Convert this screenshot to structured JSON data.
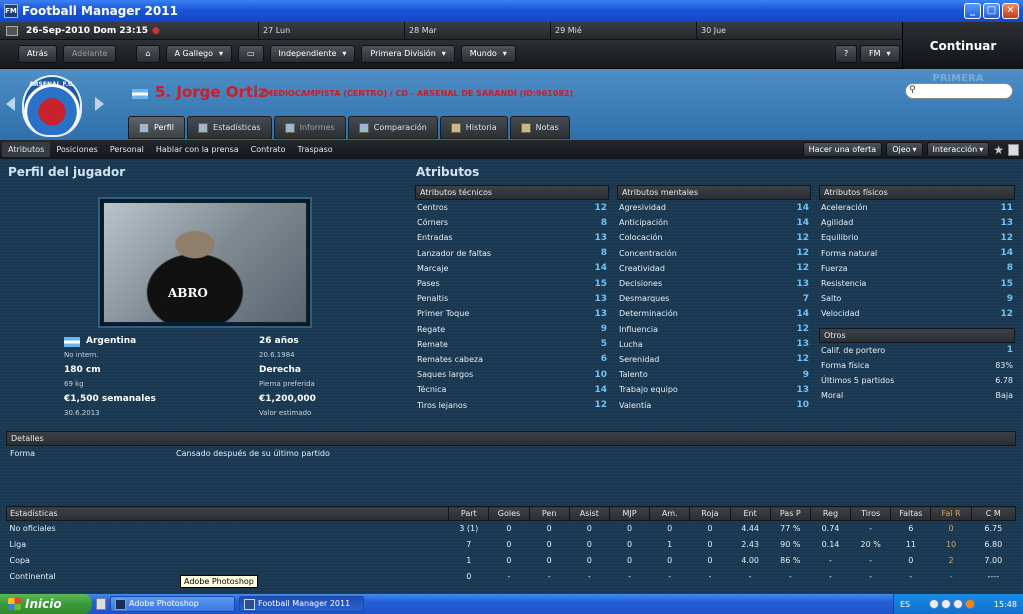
{
  "window": {
    "title": "Football Manager 2011",
    "app_icon": "FM"
  },
  "calendar": {
    "date": "26-Sep-2010 Dom 23:15",
    "days": [
      "27 Lun",
      "28 Mar",
      "29 Mié",
      "30 Jue"
    ]
  },
  "nav": {
    "back": "Atrás",
    "forward": "Adelante",
    "home_icon": "home-icon",
    "menus": [
      "A Gallego",
      "Independiente",
      "Primera División",
      "Mundo"
    ],
    "help": "?",
    "fm": "FM",
    "continue": "Continuar"
  },
  "header": {
    "crest_text": "ARSENAL F.C.",
    "name": "5. Jorge Ortiz",
    "subtitle": "MEDIOCAMPISTA (CENTRO) / CD - ARSENAL DE SARANDÍ (ID:961082)",
    "search_placeholder": "",
    "watermark": "PRIMERA DIVISIÓN"
  },
  "tabs": [
    {
      "label": "Perfil"
    },
    {
      "label": "Estadísticas"
    },
    {
      "label": "Informes"
    },
    {
      "label": "Comparación"
    },
    {
      "label": "Historia"
    },
    {
      "label": "Notas"
    }
  ],
  "subnav": {
    "items": [
      "Atributos",
      "Posiciones",
      "Personal",
      "Hablar con la prensa",
      "Contrato",
      "Traspaso"
    ],
    "offer": "Hacer una oferta",
    "ojeo": "Ojeo",
    "interaccion": "Interacción"
  },
  "profile": {
    "title": "Perfil del jugador",
    "shirt_text": "ABRO",
    "nation": "Argentina",
    "intl": "No intern.",
    "height": "180 cm",
    "weight": "69 kg",
    "wage": "€1,500 semanales",
    "contract": "30.6.2013",
    "age": "26 años",
    "dob": "20.6.1984",
    "foot": "Derecha",
    "foot_label": "Pierna preferida",
    "value": "€1,200,000",
    "value_label": "Valor estimado"
  },
  "attributes": {
    "title": "Atributos",
    "technical": {
      "head": "Atributos técnicos",
      "rows": [
        [
          "Centros",
          "12"
        ],
        [
          "Córners",
          "8"
        ],
        [
          "Entradas",
          "13"
        ],
        [
          "Lanzador de faltas",
          "8"
        ],
        [
          "Marcaje",
          "14"
        ],
        [
          "Pases",
          "15"
        ],
        [
          "Penaltis",
          "13"
        ],
        [
          "Primer Toque",
          "13"
        ],
        [
          "Regate",
          "9"
        ],
        [
          "Remate",
          "5"
        ],
        [
          "Remates cabeza",
          "6"
        ],
        [
          "Saques largos",
          "10"
        ],
        [
          "Técnica",
          "14"
        ],
        [
          "Tiros lejanos",
          "12"
        ]
      ]
    },
    "mental": {
      "head": "Atributos mentales",
      "rows": [
        [
          "Agresividad",
          "14"
        ],
        [
          "Anticipación",
          "14"
        ],
        [
          "Colocación",
          "12"
        ],
        [
          "Concentración",
          "12"
        ],
        [
          "Creatividad",
          "12"
        ],
        [
          "Decisiones",
          "13"
        ],
        [
          "Desmarques",
          "7"
        ],
        [
          "Determinación",
          "14"
        ],
        [
          "Influencia",
          "12"
        ],
        [
          "Lucha",
          "13"
        ],
        [
          "Serenidad",
          "12"
        ],
        [
          "Talento",
          "9"
        ],
        [
          "Trabajo equipo",
          "13"
        ],
        [
          "Valentía",
          "10"
        ]
      ]
    },
    "physical": {
      "head": "Atributos físicos",
      "rows": [
        [
          "Aceleración",
          "11"
        ],
        [
          "Agilidad",
          "13"
        ],
        [
          "Equilibrio",
          "12"
        ],
        [
          "Forma natural",
          "14"
        ],
        [
          "Fuerza",
          "8"
        ],
        [
          "Resistencia",
          "15"
        ],
        [
          "Salto",
          "9"
        ],
        [
          "Velocidad",
          "12"
        ]
      ]
    },
    "other": {
      "head": "Otros",
      "rows": [
        [
          "Calif. de portero",
          "1"
        ],
        [
          "Forma física",
          "83%"
        ],
        [
          "Últimos 5 partidos",
          "6.78"
        ],
        [
          "Moral",
          "Baja"
        ]
      ]
    }
  },
  "details": {
    "head": "Detalles",
    "label": "Forma",
    "value": "Cansado después de su último partido"
  },
  "stats": {
    "headers": [
      "Estadísticas",
      "Part",
      "Goles",
      "Pen",
      "Asist",
      "MJP",
      "Am.",
      "Roja",
      "Ent",
      "Pas P",
      "Reg",
      "Tiros",
      "Faltas",
      "Fal R",
      "C M"
    ],
    "rows": [
      [
        "No oficiales",
        "3 (1)",
        "0",
        "0",
        "0",
        "0",
        "0",
        "0",
        "4.44",
        "77 %",
        "0.74",
        "-",
        "6",
        "0",
        "6.75"
      ],
      [
        "Liga",
        "7",
        "0",
        "0",
        "0",
        "0",
        "1",
        "0",
        "2.43",
        "90 %",
        "0.14",
        "20 %",
        "11",
        "10",
        "6.80"
      ],
      [
        "Copa",
        "1",
        "0",
        "0",
        "0",
        "0",
        "0",
        "0",
        "4.00",
        "86 %",
        "-",
        "-",
        "0",
        "2",
        "7.00"
      ],
      [
        "Continental",
        "0",
        "-",
        "-",
        "-",
        "-",
        "-",
        "-",
        "-",
        "-",
        "-",
        "-",
        "-",
        "-",
        "----"
      ]
    ]
  },
  "tooltip": "Adobe Photoshop",
  "taskbar": {
    "start": "Inicio",
    "items": [
      "Adobe Photoshop",
      "Football Manager 2011"
    ],
    "lang": "ES",
    "clock": "15:48"
  }
}
